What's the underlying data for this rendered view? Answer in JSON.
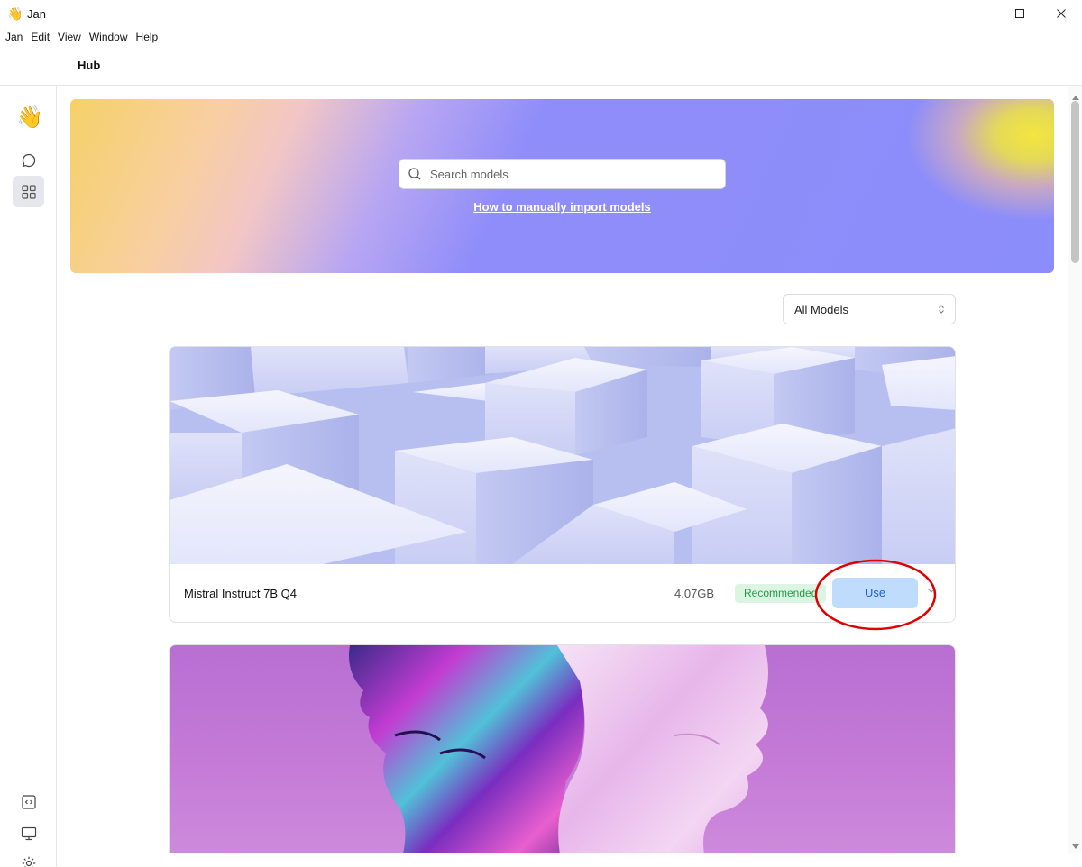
{
  "window": {
    "title": "Jan",
    "app_icon": "👋",
    "controls": {
      "minimize": "minimize-icon",
      "maximize": "maximize-icon",
      "close": "close-icon"
    }
  },
  "menu": [
    "Jan",
    "Edit",
    "View",
    "Window",
    "Help"
  ],
  "header": {
    "title": "Hub"
  },
  "rail": {
    "logo": "👋",
    "items": [
      {
        "icon": "chat-icon",
        "active": false
      },
      {
        "icon": "hub-grid-icon",
        "active": true
      }
    ],
    "bottom_items": [
      {
        "icon": "api-server-icon"
      },
      {
        "icon": "monitor-icon"
      },
      {
        "icon": "settings-gear-icon"
      }
    ]
  },
  "hero": {
    "search_placeholder": "Search models",
    "import_link": "How to manually import models"
  },
  "filter": {
    "selected": "All Models"
  },
  "models": [
    {
      "name": "Mistral Instruct 7B Q4",
      "size": "4.07GB",
      "badge": "Recommended",
      "action": "Use"
    },
    {
      "name": "",
      "size": "",
      "badge": "",
      "action": ""
    }
  ],
  "colors": {
    "accent": "#bfdcfc",
    "accent_text": "#1f5fd6",
    "badge_bg": "#dcf5e3",
    "badge_text": "#1f9d4a",
    "annotation": "#e00000"
  }
}
